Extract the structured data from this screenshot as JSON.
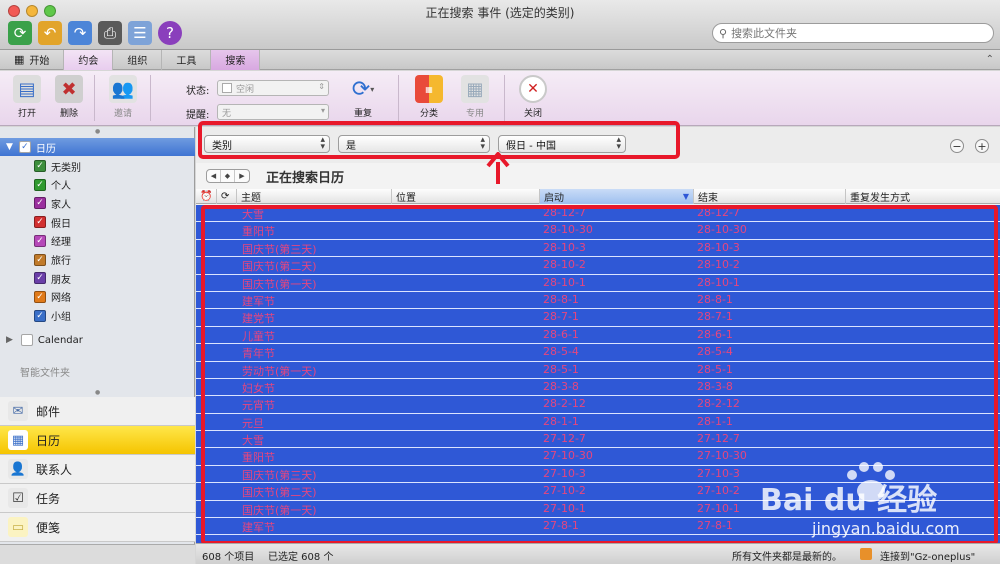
{
  "window": {
    "title": "正在搜索 事件 (选定的类别)",
    "search_placeholder": "搜索此文件夹"
  },
  "tabs": [
    {
      "label": "开始"
    },
    {
      "label": "约会"
    },
    {
      "label": "组织"
    },
    {
      "label": "工具"
    },
    {
      "label": "搜索"
    }
  ],
  "ribbon": {
    "open": "打开",
    "delete": "删除",
    "invite": "邀请",
    "status_label": "状态:",
    "status_value": "空闲",
    "reminder_label": "提醒:",
    "reminder_value": "无",
    "recurrence": "重复",
    "categorize": "分类",
    "private": "专用",
    "close": "关闭"
  },
  "sidebar": {
    "calendar_header": "日历",
    "categories": [
      {
        "label": "无类别",
        "color": "#3d8f3d"
      },
      {
        "label": "个人",
        "color": "#2f9a2f"
      },
      {
        "label": "家人",
        "color": "#9a2f9e"
      },
      {
        "label": "假日",
        "color": "#d23030"
      },
      {
        "label": "经理",
        "color": "#b548b8"
      },
      {
        "label": "旅行",
        "color": "#c07a2a"
      },
      {
        "label": "朋友",
        "color": "#6a3fa8"
      },
      {
        "label": "网络",
        "color": "#e07a1a"
      },
      {
        "label": "小组",
        "color": "#3a6fc8"
      }
    ],
    "calendar_label": "Calendar",
    "smart_folders": "智能文件夹",
    "nav": [
      {
        "label": "邮件",
        "icon": "mail-icon"
      },
      {
        "label": "日历",
        "icon": "calendar-icon"
      },
      {
        "label": "联系人",
        "icon": "contacts-icon"
      },
      {
        "label": "任务",
        "icon": "tasks-icon"
      },
      {
        "label": "便笺",
        "icon": "notes-icon"
      }
    ]
  },
  "filters": {
    "field": "类别",
    "operator": "是",
    "value": "假日 - 中国"
  },
  "search_title": "正在搜索日历",
  "columns": {
    "subject": "主题",
    "location": "位置",
    "start": "启动",
    "end": "结束",
    "recurrence": "重复发生方式"
  },
  "rows": [
    {
      "subject": "大雪",
      "start": "28-12-7",
      "end": "28-12-7"
    },
    {
      "subject": "重阳节",
      "start": "28-10-30",
      "end": "28-10-30"
    },
    {
      "subject": "国庆节(第三天)",
      "start": "28-10-3",
      "end": "28-10-3"
    },
    {
      "subject": "国庆节(第二天)",
      "start": "28-10-2",
      "end": "28-10-2"
    },
    {
      "subject": "国庆节(第一天)",
      "start": "28-10-1",
      "end": "28-10-1"
    },
    {
      "subject": "建军节",
      "start": "28-8-1",
      "end": "28-8-1"
    },
    {
      "subject": "建党节",
      "start": "28-7-1",
      "end": "28-7-1"
    },
    {
      "subject": "儿童节",
      "start": "28-6-1",
      "end": "28-6-1"
    },
    {
      "subject": "青年节",
      "start": "28-5-4",
      "end": "28-5-4"
    },
    {
      "subject": "劳动节(第一天)",
      "start": "28-5-1",
      "end": "28-5-1"
    },
    {
      "subject": "妇女节",
      "start": "28-3-8",
      "end": "28-3-8"
    },
    {
      "subject": "元宵节",
      "start": "28-2-12",
      "end": "28-2-12"
    },
    {
      "subject": "元旦",
      "start": "28-1-1",
      "end": "28-1-1"
    },
    {
      "subject": "大雪",
      "start": "27-12-7",
      "end": "27-12-7"
    },
    {
      "subject": "重阳节",
      "start": "27-10-30",
      "end": "27-10-30"
    },
    {
      "subject": "国庆节(第三天)",
      "start": "27-10-3",
      "end": "27-10-3"
    },
    {
      "subject": "国庆节(第二天)",
      "start": "27-10-2",
      "end": "27-10-2"
    },
    {
      "subject": "国庆节(第一天)",
      "start": "27-10-1",
      "end": "27-10-1"
    },
    {
      "subject": "建军节",
      "start": "27-8-1",
      "end": "27-8-1"
    }
  ],
  "status": {
    "count": "608 个项目",
    "selected": "已选定 608 个",
    "uptodate": "所有文件夹都是最新的。",
    "connection": "连接到\"Gz-oneplus\""
  },
  "watermark": {
    "brand": "Bai du 经验",
    "url": "jingyan.baidu.com"
  },
  "colors": {
    "selection": "#2f58d6",
    "highlight_box": "#e8182a",
    "row_text": "#e6467f"
  }
}
